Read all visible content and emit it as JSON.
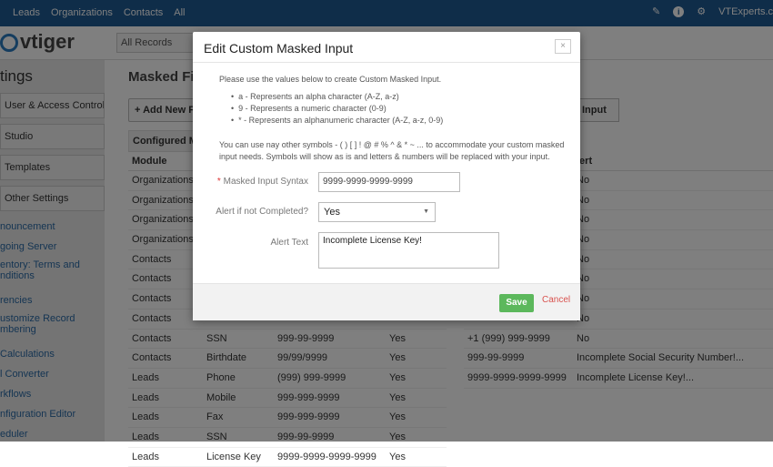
{
  "topbar": {
    "nav": [
      "Leads",
      "Organizations",
      "Contacts",
      "All"
    ],
    "user": "VTExperts.c"
  },
  "header": {
    "logo": "vtiger",
    "all_records": "All Records"
  },
  "sidebar": {
    "title": "tings",
    "sections": [
      "User & Access Control",
      "Studio",
      "Templates",
      "Other Settings"
    ],
    "links": [
      "nouncement",
      "going Server",
      "entory: Terms and nditions",
      "rencies",
      "ustomize Record mbering",
      "Calculations",
      "l Converter",
      "rkflows",
      "nfiguration Editor",
      "eduler"
    ]
  },
  "main": {
    "page_title": "Masked Fiel",
    "add_button": "Add New F",
    "input_button": "Input",
    "panel1_header": "Configured Mask",
    "col_module": "Module",
    "col_alert": "lert",
    "rows": [
      {
        "module": "Organizations",
        "field": "",
        "mask": "",
        "alert": ""
      },
      {
        "module": "Organizations",
        "field": "",
        "mask": "",
        "alert": ""
      },
      {
        "module": "Organizations",
        "field": "",
        "mask": "",
        "alert": ""
      },
      {
        "module": "Organizations",
        "field": "",
        "mask": "",
        "alert": ""
      },
      {
        "module": "Contacts",
        "field": "",
        "mask": "",
        "alert": ""
      },
      {
        "module": "Contacts",
        "field": "",
        "mask": "",
        "alert": ""
      },
      {
        "module": "Contacts",
        "field": "",
        "mask": "",
        "alert": ""
      },
      {
        "module": "Contacts",
        "field": "",
        "mask": "",
        "alert": ""
      },
      {
        "module": "Contacts",
        "field": "SSN",
        "mask": "999-99-9999",
        "alert": "Yes"
      },
      {
        "module": "Contacts",
        "field": "Birthdate",
        "mask": "99/99/9999",
        "alert": "Yes"
      },
      {
        "module": "Leads",
        "field": "Phone",
        "mask": "(999) 999-9999",
        "alert": "Yes"
      },
      {
        "module": "Leads",
        "field": "Mobile",
        "mask": "999-999-9999",
        "alert": "Yes"
      },
      {
        "module": "Leads",
        "field": "Fax",
        "mask": "999-999-9999",
        "alert": "Yes"
      },
      {
        "module": "Leads",
        "field": "SSN",
        "mask": "999-99-9999",
        "alert": "Yes"
      },
      {
        "module": "Leads",
        "field": "License Key",
        "mask": "9999-9999-9999-9999",
        "alert": "Yes"
      }
    ],
    "rows2": [
      {
        "syntax": "",
        "text": "No"
      },
      {
        "syntax": "",
        "text": "No"
      },
      {
        "syntax": "",
        "text": "No"
      },
      {
        "syntax": "",
        "text": "No"
      },
      {
        "syntax": "",
        "text": "No"
      },
      {
        "syntax": "",
        "text": "No"
      },
      {
        "syntax": "",
        "text": "No"
      },
      {
        "syntax": "",
        "text": "No"
      },
      {
        "syntax": "+1 (999) 999-9999",
        "text": "No"
      },
      {
        "syntax": "999-99-9999",
        "text": "Incomplete Social Security Number!..."
      },
      {
        "syntax": "9999-9999-9999-9999",
        "text": "Incomplete License Key!..."
      }
    ]
  },
  "modal": {
    "title": "Edit Custom Masked Input",
    "close": "×",
    "intro": "Please use the values below to create Custom Masked Input.",
    "bullets": [
      "a - Represents an alpha character (A-Z, a-z)",
      "9 - Represents a numeric character (0-9)",
      "* - Represents an alphanumeric character (A-Z, a-z, 0-9)"
    ],
    "note": "You can use nay other symbols - ( ) [ ] ! @ # % ^ & * ~ ... to accommodate your custom masked input needs. Symbols will show as is and letters & numbers will be replaced with your input.",
    "syntax_label": "Masked Input Syntax",
    "syntax_required": "*",
    "syntax_value": "9999-9999-9999-9999",
    "alert_label": "Alert if not Completed?",
    "alert_value": "Yes",
    "alert_text_label": "Alert Text",
    "alert_text_value": "Incomplete License Key!",
    "save": "Save",
    "cancel": "Cancel"
  }
}
